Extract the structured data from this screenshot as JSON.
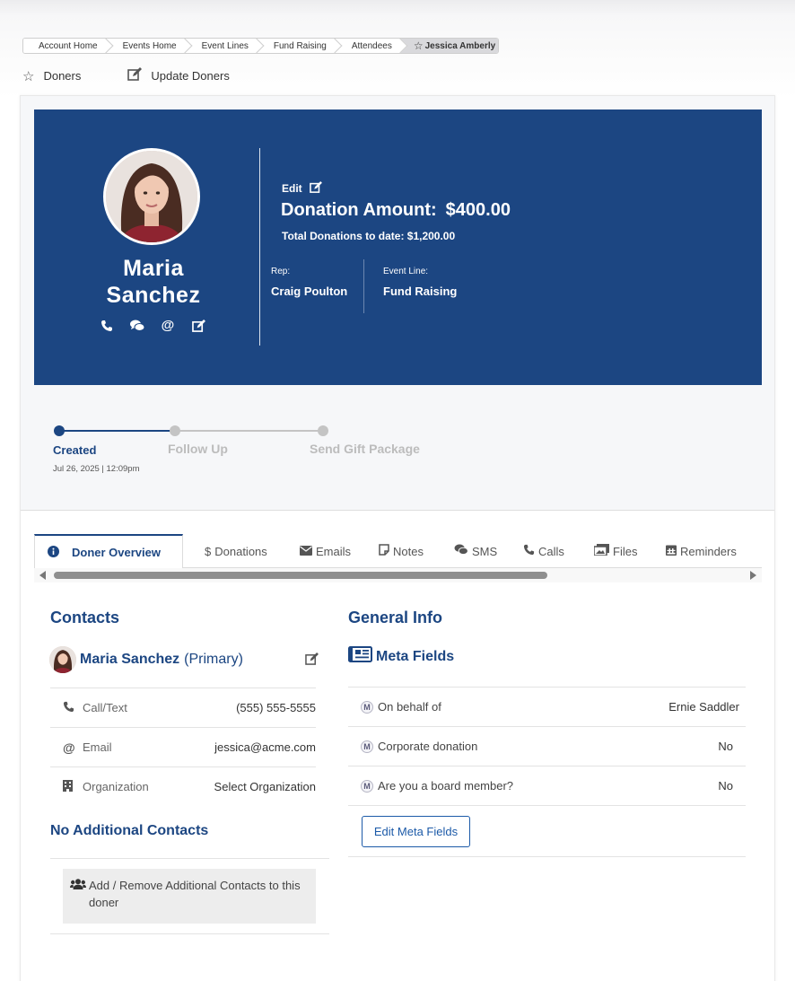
{
  "breadcrumb": {
    "items": [
      "Account Home",
      "Events Home",
      "Event Lines",
      "Fund Raising",
      "Attendees"
    ],
    "active": "Jessica Amberly"
  },
  "toplinks": {
    "doners": "Doners",
    "update": "Update Doners"
  },
  "profile": {
    "first_name": "Maria",
    "last_name": "Sanchez",
    "edit_label": "Edit",
    "donation_label": "Donation Amount:",
    "donation_value": "$400.00",
    "total_label": "Total Donations to date: $1,200.00",
    "rep_label": "Rep:",
    "rep_value": "Craig Poulton",
    "event_line_label": "Event Line:",
    "event_line_value": "Fund Raising"
  },
  "progress": {
    "stages": [
      {
        "label": "Created",
        "status": "done",
        "date": "Jul 26, 2025 | 12:09pm"
      },
      {
        "label": "Follow Up",
        "status": "todo"
      },
      {
        "label": "Send Gift Package",
        "status": "todo"
      }
    ]
  },
  "tabs": [
    {
      "label": "Doner Overview",
      "icon": "info-icon",
      "active": true
    },
    {
      "label": "Donations",
      "icon": "dollar-icon"
    },
    {
      "label": "Emails",
      "icon": "envelope-icon"
    },
    {
      "label": "Notes",
      "icon": "note-icon"
    },
    {
      "label": "SMS",
      "icon": "chat-icon"
    },
    {
      "label": "Calls",
      "icon": "phone-icon"
    },
    {
      "label": "Files",
      "icon": "images-icon"
    },
    {
      "label": "Reminders",
      "icon": "calendar-icon"
    }
  ],
  "contacts": {
    "title": "Contacts",
    "primary_name": "Maria Sanchez",
    "primary_tag": "(Primary)",
    "rows": [
      {
        "label": "Call/Text",
        "icon": "phone-icon",
        "value": "(555) 555-5555"
      },
      {
        "label": "Email",
        "icon": "at-icon",
        "value": "jessica@acme.com"
      },
      {
        "label": "Organization",
        "icon": "building-icon",
        "value": "Select Organization"
      }
    ],
    "no_additional": "No Additional Contacts",
    "add_remove": "Add / Remove Additional Contacts to this doner"
  },
  "general": {
    "title": "General Info",
    "meta_title": "Meta Fields",
    "badge": "M",
    "fields": [
      {
        "label": "On behalf of",
        "value": "Ernie Saddler"
      },
      {
        "label": "Corporate donation",
        "value": "No"
      },
      {
        "label": "Are you a board member?",
        "value": "No"
      }
    ],
    "edit_button": "Edit Meta Fields"
  },
  "colors": {
    "primary": "#1c4682",
    "inactive": "#c4c4c4",
    "button": "#1c5aa8"
  }
}
